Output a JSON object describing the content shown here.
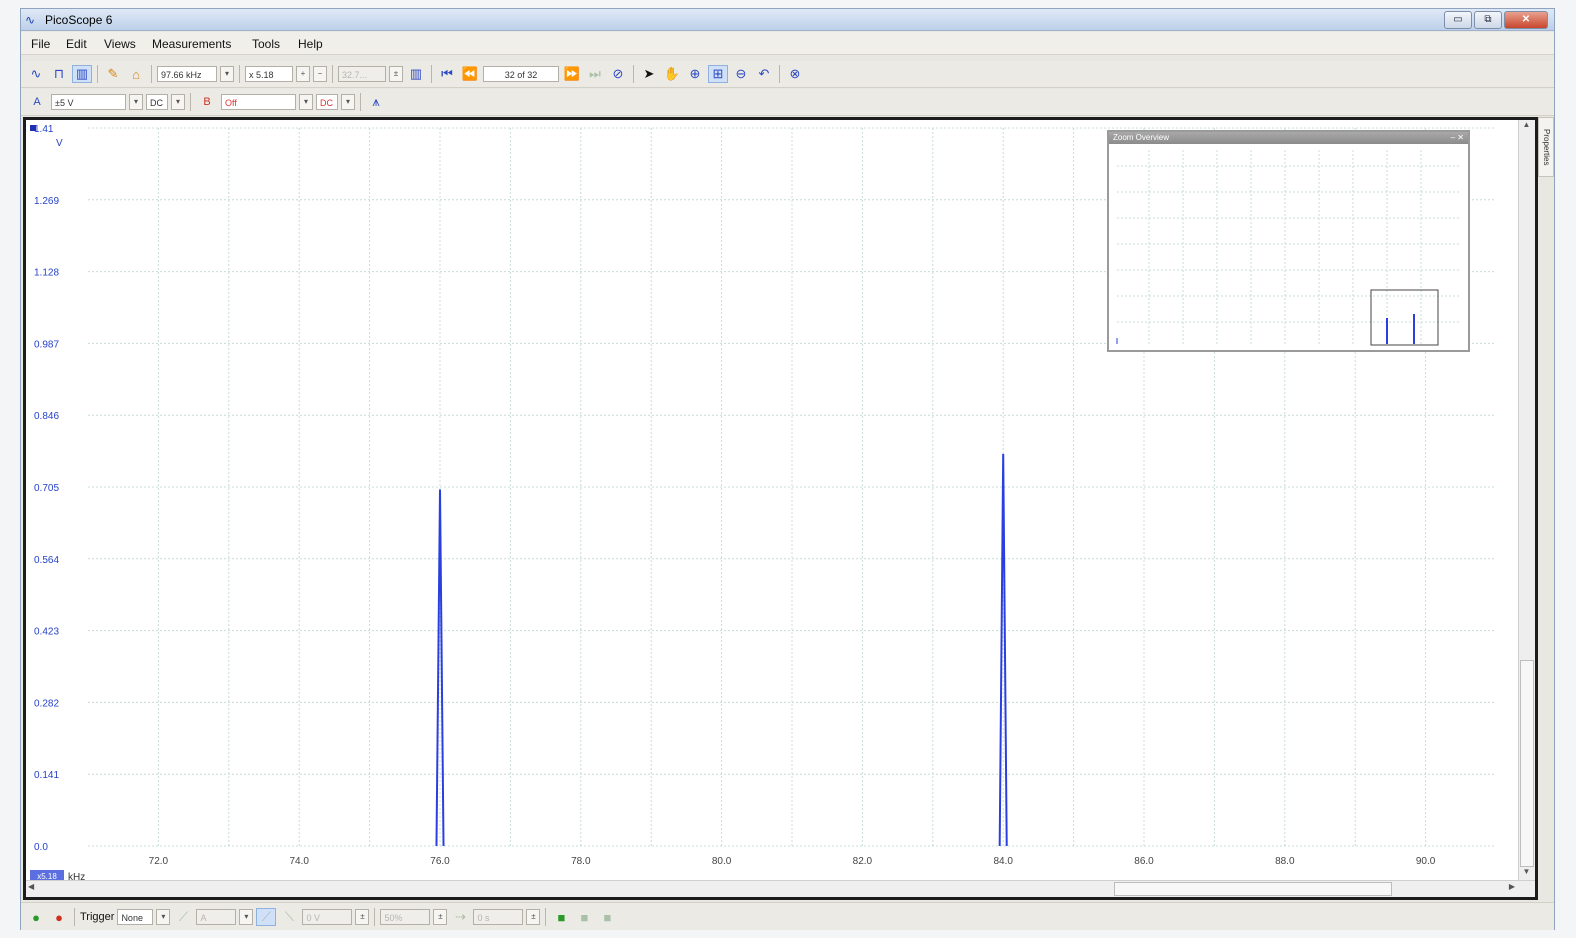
{
  "window": {
    "title": "PicoScope 6",
    "minimize": "▭",
    "maximize": "⧉",
    "close": "✕"
  },
  "menu": [
    {
      "label": "File"
    },
    {
      "label": "Edit"
    },
    {
      "label": "Views"
    },
    {
      "label": "Measurements"
    },
    {
      "label": "Tools"
    },
    {
      "label": "Help"
    }
  ],
  "toolbar1": {
    "sample_rate": "97.66 kHz",
    "zoom": "x 5.18",
    "zoom_value_disabled": "32.7...",
    "buffer": "32 of 32"
  },
  "toolbar2": {
    "channel_a_label": "A",
    "channel_a_range": "±5 V",
    "channel_a_coupling": "DC",
    "channel_b_label": "B",
    "channel_b_range": "Off",
    "channel_b_coupling": "DC"
  },
  "plot": {
    "y_unit": "V",
    "y_ticks": [
      "1.41",
      "1.269",
      "1.128",
      "0.987",
      "0.846",
      "0.705",
      "0.564",
      "0.423",
      "0.282",
      "0.141",
      "0.0"
    ],
    "x_ticks": [
      "72.0",
      "74.0",
      "76.0",
      "78.0",
      "80.0",
      "82.0",
      "84.0",
      "86.0",
      "88.0",
      "90.0"
    ],
    "x_unit": "kHz",
    "x_unit_badge": "x5.18",
    "zoom_overview_title": "Zoom Overview",
    "zoom_overview_buttons": "– ✕",
    "properties_tab": "Properties"
  },
  "statusbar": {
    "trigger_label": "Trigger",
    "trigger_mode": "None",
    "trigger_channel": "A",
    "threshold": "0 V",
    "pre_trigger": "50%",
    "delay": "0 s"
  },
  "chart_data": {
    "type": "line",
    "xlabel": "kHz",
    "ylabel": "V",
    "xlim": [
      71.0,
      91.0
    ],
    "ylim": [
      0.0,
      1.41
    ],
    "grid": true,
    "series": [
      {
        "x": [
          75.95,
          76.0,
          76.05
        ],
        "y": [
          0.0,
          0.7,
          0.0
        ]
      },
      {
        "x": [
          83.95,
          84.0,
          84.05
        ],
        "y": [
          0.0,
          0.77,
          0.0
        ]
      }
    ],
    "color": "#2a3fe0"
  }
}
